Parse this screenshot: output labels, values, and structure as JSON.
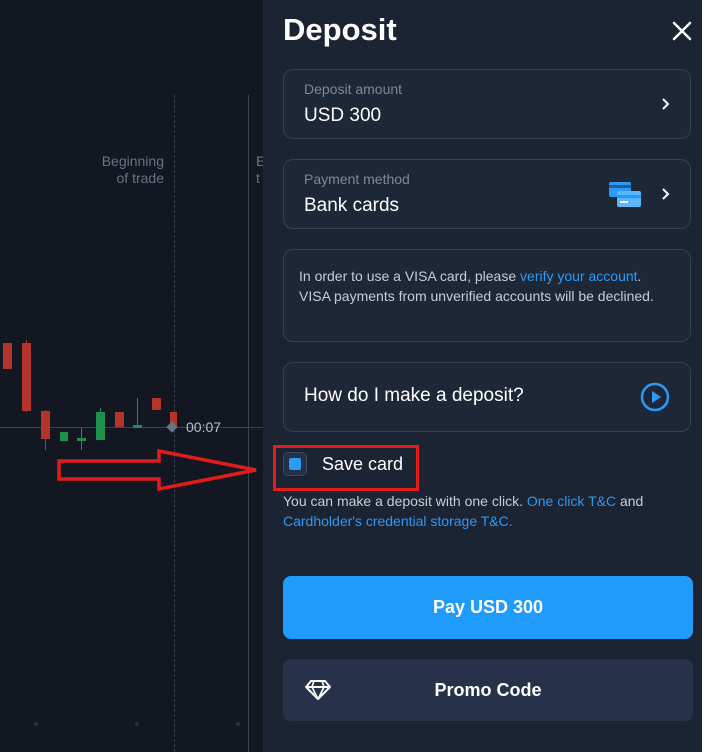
{
  "chart": {
    "beginning_label_line1": "Beginning",
    "beginning_label_line2": "of trade",
    "second_label_line1": "E",
    "second_label_line2": "t",
    "timer": "00:07"
  },
  "deposit": {
    "title": "Deposit",
    "amount_label": "Deposit amount",
    "amount_value": "USD 300",
    "method_label": "Payment method",
    "method_value": "Bank cards",
    "notice_before_link": "In order to use a VISA card, please ",
    "notice_link": "verify your account",
    "notice_after_link": ". VISA payments from unverified accounts will be declined.",
    "howto": "How do I make a deposit?",
    "save_card_label": "Save card",
    "oneclick_text": "You can make a deposit with one click. ",
    "oneclick_link": "One click T&C",
    "oneclick_and": " and ",
    "storage_link": "Cardholder's credential storage T&C.",
    "pay_button": "Pay USD 300",
    "promo_button": "Promo Code"
  },
  "colors": {
    "accent": "#1f9bfb",
    "panel": "#1c2434",
    "annotation": "#e11c1c"
  }
}
